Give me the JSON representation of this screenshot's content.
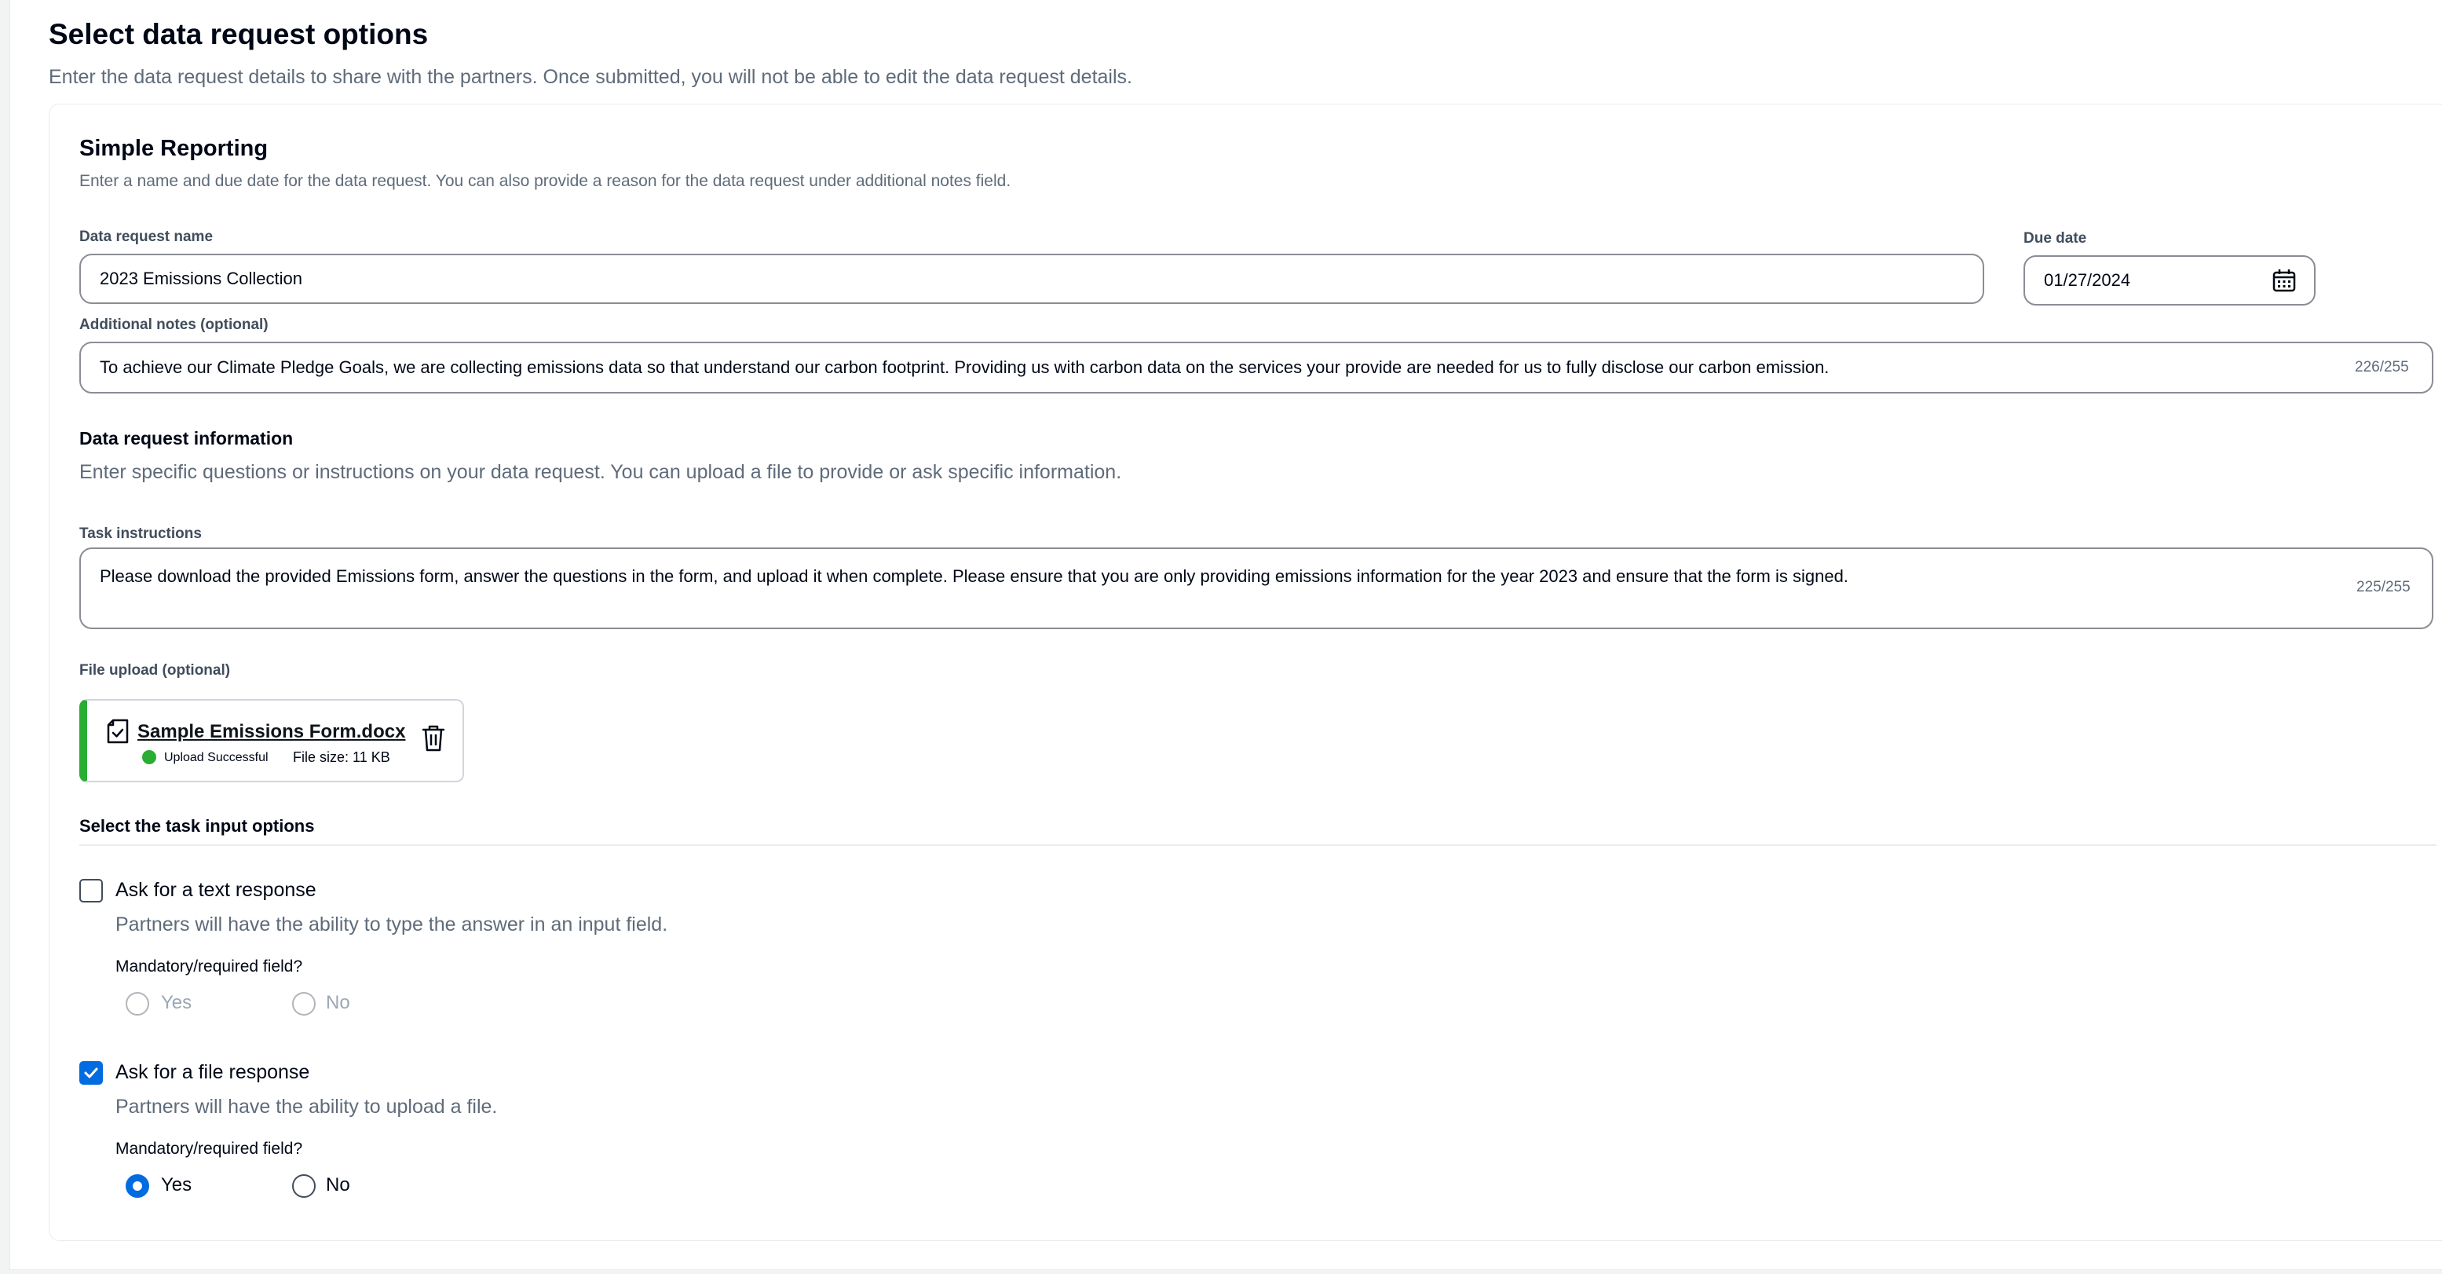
{
  "header": {
    "title": "Select data request options",
    "description": "Enter the data request details to share with the partners. Once submitted, you will not be able to edit the data request details."
  },
  "card": {
    "title": "Simple Reporting",
    "description": "Enter a name and due date for the data request. You can also provide a reason for the data request under additional notes field."
  },
  "fields": {
    "name_label": "Data request name",
    "name_value": "2023 Emissions Collection",
    "due_label": "Due date",
    "due_value": "01/27/2024",
    "notes_label": "Additional notes (optional)",
    "notes_value": "To achieve our Climate Pledge Goals, we are collecting emissions data so that understand our carbon footprint. Providing us with carbon data on the services your provide are needed for us to fully disclose our carbon emission.",
    "notes_counter": "226/255"
  },
  "info": {
    "title": "Data request information",
    "description": "Enter specific questions or instructions on your data request. You can upload a file to provide or ask specific information.",
    "instructions_label": "Task instructions",
    "instructions_value": "Please download the provided Emissions form, answer the questions in the form, and upload it when complete. Please ensure that you are only providing emissions information for the year 2023 and ensure that the form is signed.",
    "instructions_counter": "225/255"
  },
  "upload": {
    "label": "File upload (optional)",
    "file_name": "Sample Emissions Form.docx",
    "status": "Upload Successful",
    "file_size": "File size: 11 KB"
  },
  "task_options": {
    "title": "Select the task input options",
    "options": [
      {
        "label": "Ask for a text response",
        "description": "Partners will have the ability to type the answer in an input field.",
        "checked": false,
        "mandatory_label": "Mandatory/required field?",
        "yes": "Yes",
        "no": "No",
        "selected": "none"
      },
      {
        "label": "Ask for a file response",
        "description": "Partners will have the ability to upload a file.",
        "checked": true,
        "mandatory_label": "Mandatory/required field?",
        "yes": "Yes",
        "no": "No",
        "selected": "Yes"
      }
    ]
  },
  "colors": {
    "accent": "#006ce0",
    "success": "#29ad32",
    "text": "#000716",
    "muted": "#5f6b7a"
  }
}
